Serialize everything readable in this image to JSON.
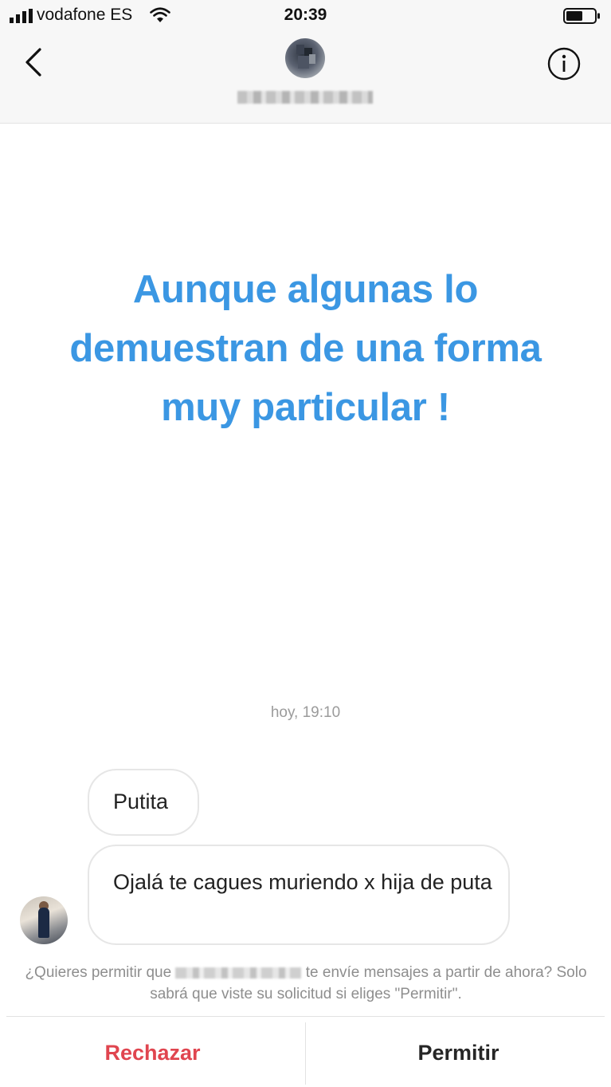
{
  "status_bar": {
    "carrier": "vodafone ES",
    "time": "20:39",
    "icons": [
      "signal-bars-icon",
      "wifi-icon",
      "battery-icon"
    ]
  },
  "header": {
    "icons": [
      "back-chevron-icon",
      "info-icon"
    ],
    "profile_name_blurred": true
  },
  "overlay": {
    "headline_line1": "Aunque algunas lo",
    "headline_line2": "demuestran de una forma",
    "headline_line3": "muy particular !",
    "color": "#3b97e3"
  },
  "thread": {
    "timestamp": "hoy, 19:10",
    "messages": [
      {
        "text": "Putita"
      },
      {
        "text": "Ojalá te cagues muriendo x hija de puta"
      }
    ]
  },
  "request": {
    "prompt_before": "¿Quieres permitir que",
    "prompt_after": "te envíe mensajes a partir de ahora? Solo sabrá que viste su solicitud si eliges \"Permitir\".",
    "reject_label": "Rechazar",
    "allow_label": "Permitir",
    "reject_color": "#e0454f"
  }
}
